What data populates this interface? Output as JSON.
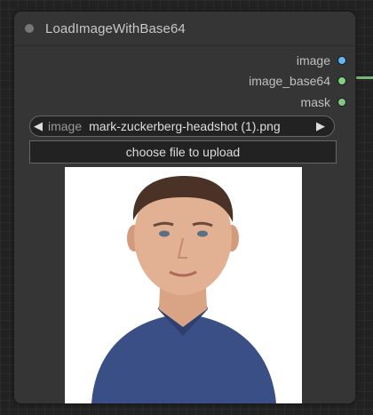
{
  "node": {
    "title": "LoadImageWithBase64",
    "outputs": [
      {
        "label": "image",
        "color": "#64b5f6"
      },
      {
        "label": "image_base64",
        "color": "#7ed37e"
      },
      {
        "label": "mask",
        "color": "#81c784"
      }
    ],
    "image_widget": {
      "name": "image",
      "value": "mark-zuckerberg-headshot (1).png",
      "left_arrow": "◀",
      "right_arrow": "▶"
    },
    "upload_button": "choose file to upload"
  }
}
